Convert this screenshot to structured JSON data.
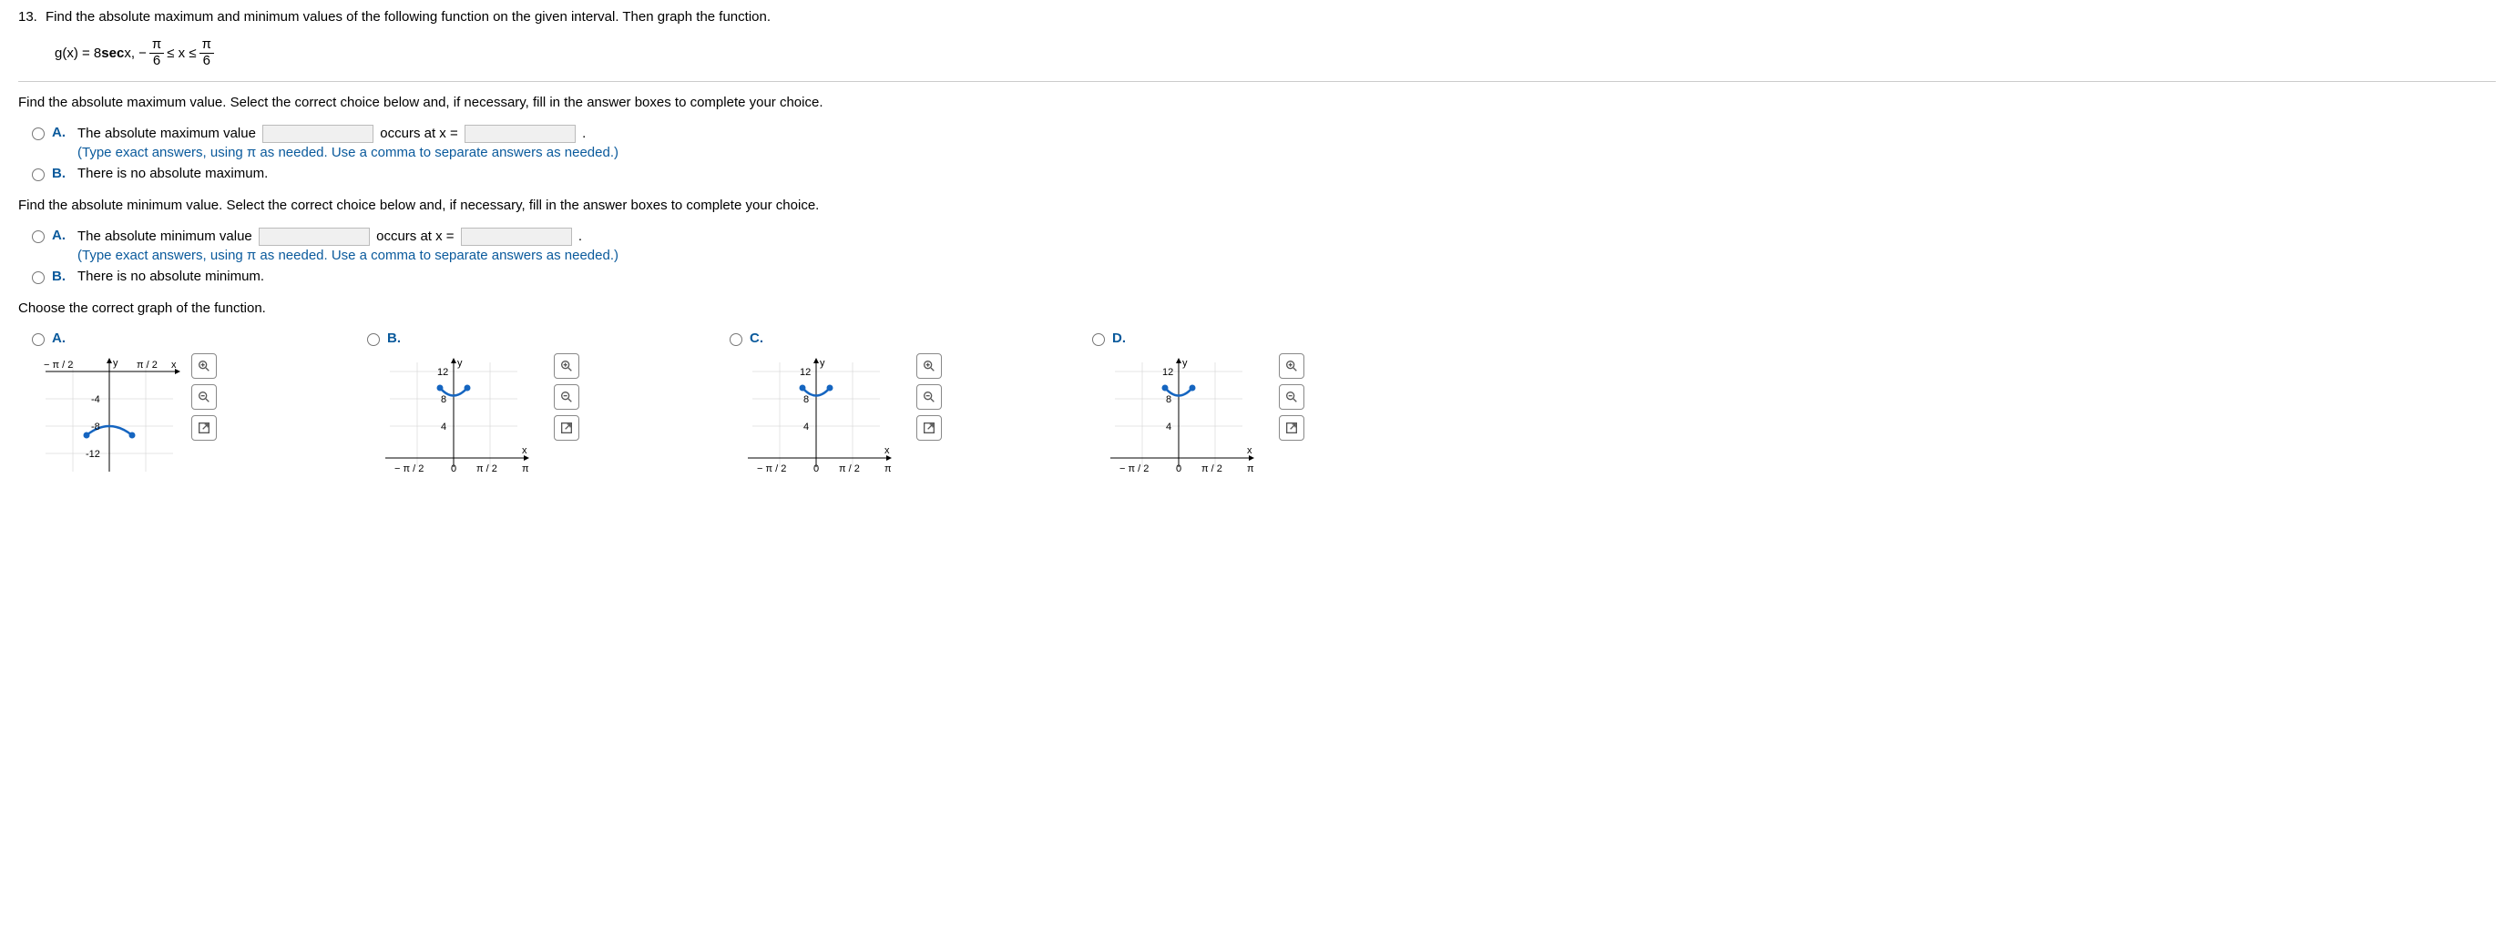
{
  "question": {
    "number": "13.",
    "prompt": "Find the absolute maximum and minimum values of the following function on the given interval. Then graph the function.",
    "formula_prefix": "g(x) = 8 ",
    "formula_func": "sec",
    "formula_var": " x,   − ",
    "pi": "π",
    "six": "6",
    "leq": " ≤ x ≤ "
  },
  "max_section": {
    "prompt": "Find the absolute maximum value. Select the correct choice below and, if necessary, fill in the answer boxes to complete your choice.",
    "A_label": "A.",
    "A_text_1": "The absolute maximum value ",
    "A_text_2": " occurs at x = ",
    "A_text_3": ".",
    "A_hint": "(Type exact answers, using π as needed. Use a comma to separate answers as needed.)",
    "B_label": "B.",
    "B_text": "There is no absolute maximum."
  },
  "min_section": {
    "prompt": "Find the absolute minimum value. Select the correct choice below and, if necessary, fill in the answer boxes to complete your choice.",
    "A_label": "A.",
    "A_text_1": "The absolute minimum value ",
    "A_text_2": " occurs at x = ",
    "A_text_3": ".",
    "A_hint": "(Type exact answers, using π as needed. Use a comma to separate answers as needed.)",
    "B_label": "B.",
    "B_text": "There is no absolute minimum."
  },
  "graph_prompt": "Choose the correct graph of the function.",
  "graph_options": {
    "A": "A.",
    "B": "B.",
    "C": "C.",
    "D": "D."
  },
  "axis": {
    "x": "x",
    "y": "y",
    "neg_pi_2": "− π / 2",
    "pi_2": "π / 2",
    "pi": "π",
    "zero": "0",
    "t12": "12",
    "t8": "8",
    "t4": "4",
    "tn4": "-4",
    "tn8": "-8",
    "tn12": "-12"
  },
  "chart_data": [
    {
      "option": "A",
      "type": "line",
      "orientation": "down",
      "x_range": [
        "-π/2",
        "π/2"
      ],
      "y_range": [
        -12,
        0
      ],
      "curve_x": [
        -0.524,
        0,
        0.524
      ],
      "curve_y": [
        -9.24,
        -8,
        -9.24
      ],
      "endpoints_filled": true,
      "xlabel": "x",
      "ylabel": "y",
      "xticks": [
        "-π/2",
        "π/2"
      ],
      "yticks": [
        -4,
        -8,
        -12
      ]
    },
    {
      "option": "B",
      "type": "line",
      "orientation": "up",
      "x_range": [
        "-π/2",
        "π"
      ],
      "y_range": [
        0,
        12
      ],
      "curve_x": [
        -0.524,
        0,
        0.524
      ],
      "curve_y": [
        9.24,
        8,
        9.24
      ],
      "endpoints_filled": true,
      "right_endpoint_open": false,
      "xlabel": "x",
      "ylabel": "y",
      "xticks": [
        "-π/2",
        "0",
        "π/2",
        "π"
      ],
      "yticks": [
        4,
        8,
        12
      ]
    },
    {
      "option": "C",
      "type": "line",
      "orientation": "up",
      "x_range": [
        "-π/2",
        "π"
      ],
      "y_range": [
        0,
        12
      ],
      "curve_x": [
        -0.524,
        0,
        0.524
      ],
      "curve_y": [
        9.24,
        8,
        9.24
      ],
      "endpoints_filled": true,
      "xlabel": "x",
      "ylabel": "y",
      "xticks": [
        "-π/2",
        "0",
        "π/2",
        "π"
      ],
      "yticks": [
        4,
        8,
        12
      ]
    },
    {
      "option": "D",
      "type": "line",
      "orientation": "up",
      "x_range": [
        "-π/2",
        "π"
      ],
      "y_range": [
        0,
        12
      ],
      "curve_x": [
        -0.524,
        0,
        0.524
      ],
      "curve_y": [
        9.24,
        8,
        9.24
      ],
      "endpoints_filled": true,
      "xlabel": "x",
      "ylabel": "y",
      "xticks": [
        "-π/2",
        "0",
        "π/2",
        "π"
      ],
      "yticks": [
        4,
        8,
        12
      ]
    }
  ]
}
